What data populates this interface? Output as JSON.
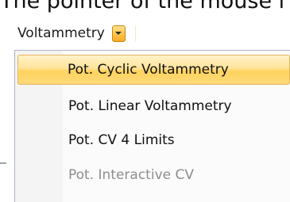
{
  "caption": "The pointer of the mouse i",
  "combo": {
    "label": "Voltammetry"
  },
  "menu": {
    "items": [
      {
        "label": "Pot. Cyclic Voltammetry",
        "state": "highlighted"
      },
      {
        "label": "Pot. Linear Voltammetry",
        "state": "enabled"
      },
      {
        "label": "Pot. CV 4 Limits",
        "state": "enabled"
      },
      {
        "label": "Pot. Interactive CV",
        "state": "disabled"
      }
    ]
  },
  "colors": {
    "highlight": "#ffd35e",
    "combo_button": "#ffc34a",
    "disabled_text": "#8d8d8d",
    "menu_border": "#a9b5c2"
  }
}
